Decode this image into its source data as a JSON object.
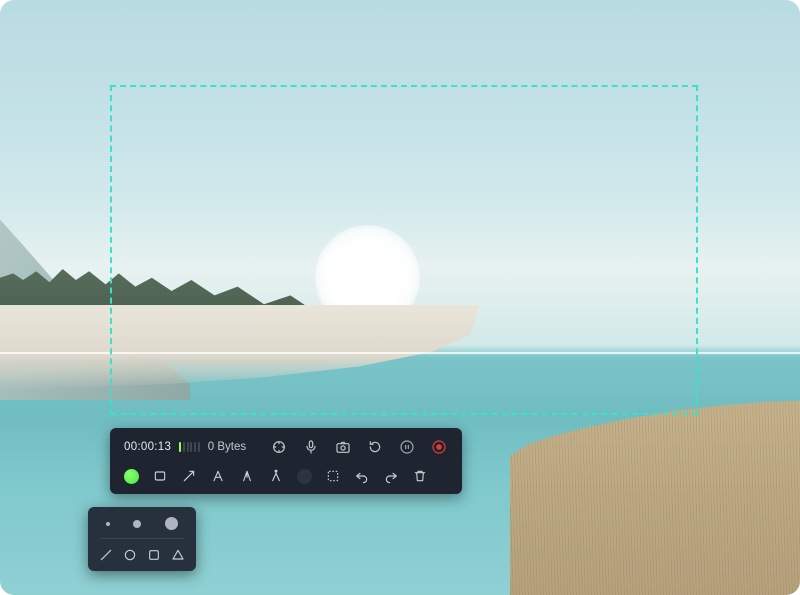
{
  "recording": {
    "elapsed": "00:00:13",
    "file_size": "0 Bytes",
    "audio_level_bars_total": 6,
    "audio_level_bars_active": 1
  },
  "top_controls": {
    "cursor_icon": "cursor-icon",
    "mic_icon": "microphone-icon",
    "camera_icon": "camera-icon",
    "reset_icon": "reset-icon",
    "pause_icon": "pause-icon",
    "stop_icon": "stop-record-icon"
  },
  "draw_tools": {
    "color_current": "#46e84c",
    "tools": [
      "rectangle",
      "arrow",
      "text",
      "pen",
      "compass",
      "dark-color",
      "marquee",
      "undo",
      "redo",
      "trash"
    ]
  },
  "popup": {
    "sizes": [
      "small",
      "medium",
      "large"
    ],
    "shapes": [
      "line",
      "circle",
      "square",
      "triangle"
    ]
  },
  "selection": {
    "border_color": "#3de0c8"
  }
}
